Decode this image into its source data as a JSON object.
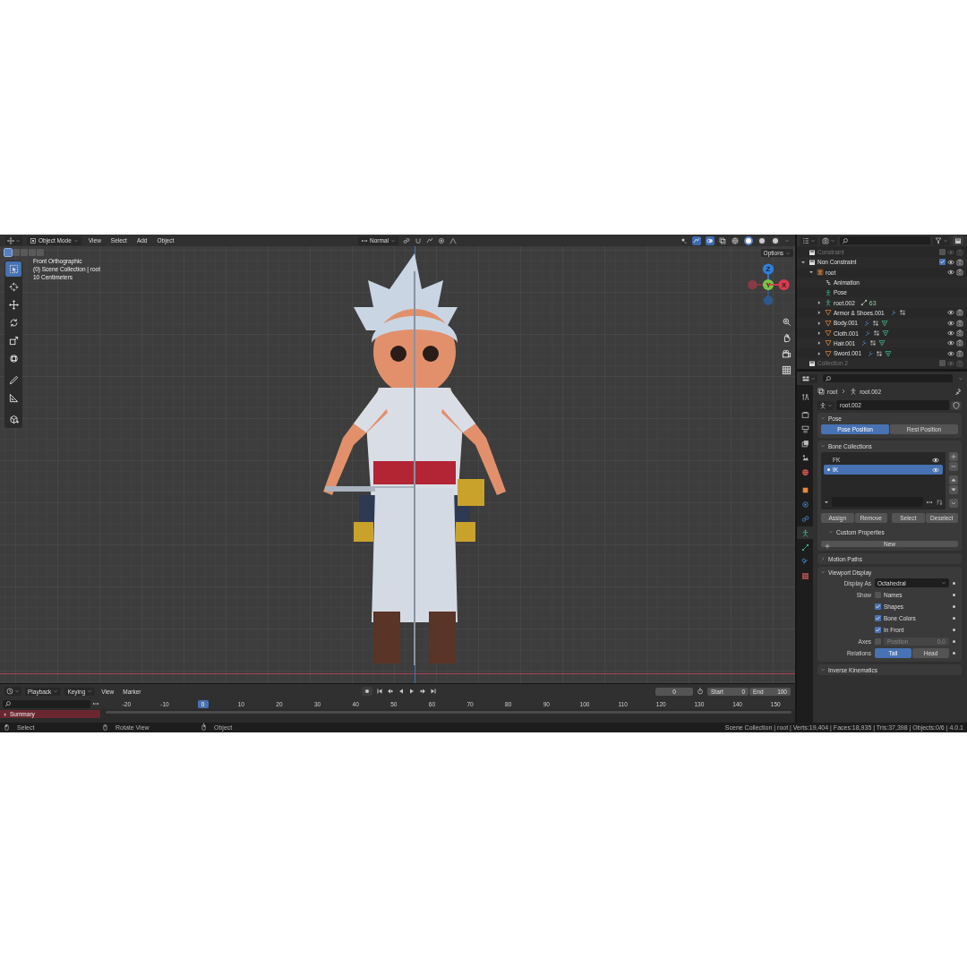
{
  "viewport": {
    "header": {
      "mode": "Object Mode",
      "menus": [
        "View",
        "Select",
        "Add",
        "Object"
      ],
      "orientation": "Normal"
    },
    "shading_modes": [
      {
        "selected": false
      },
      {
        "selected": true
      },
      {
        "selected": false
      },
      {
        "selected": false
      }
    ],
    "select_modes": [
      {
        "selected": true
      },
      {
        "selected": false
      },
      {
        "selected": false
      },
      {
        "selected": false
      },
      {
        "selected": false
      }
    ],
    "tools": [
      {
        "kind": "select-box",
        "selected": true
      },
      {
        "kind": "cursor",
        "selected": false
      },
      {
        "kind": "move",
        "selected": false
      },
      {
        "kind": "rotate",
        "selected": false
      },
      {
        "kind": "scale",
        "selected": false
      },
      {
        "kind": "transform",
        "selected": false
      },
      {
        "kind": "annotate",
        "selected": false
      },
      {
        "kind": "measure",
        "selected": false
      },
      {
        "kind": "add-cube",
        "selected": false
      }
    ],
    "info": [
      "Front Orthographic",
      "(0) Scene Collection | root",
      "10 Centimeters"
    ],
    "options": "Options",
    "gizmo": [
      {
        "label": "Z",
        "kind": "up",
        "color": "#2f7fd9"
      },
      {
        "label": "Y",
        "kind": "center",
        "color": "#7bc443"
      },
      {
        "label": "X",
        "kind": "right",
        "color": "#db3a4e"
      }
    ]
  },
  "outliner": {
    "items": [
      {
        "name": "Constraint",
        "kind": "collection",
        "checked": false
      },
      {
        "name": "Non Constraint",
        "kind": "collection",
        "checked": true,
        "expanded": true,
        "children": [
          {
            "name": "root",
            "kind": "armature",
            "expanded": true,
            "children": [
              {
                "name": "Animation",
                "kind": "animation"
              },
              {
                "name": "Pose",
                "kind": "pose"
              },
              {
                "name": "root.002",
                "kind": "bones",
                "expanded": false,
                "count": "63"
              },
              {
                "name": "Armor & Shoes.001",
                "kind": "mesh",
                "expanded": false,
                "mesh_data": false
              },
              {
                "name": "Body.001",
                "kind": "mesh",
                "expanded": false,
                "mesh_data": true
              },
              {
                "name": "Cloth.001",
                "kind": "mesh",
                "expanded": false,
                "mesh_data": true
              },
              {
                "name": "Hair.001",
                "kind": "mesh",
                "expanded": false,
                "mesh_data": true
              },
              {
                "name": "Sword.001",
                "kind": "mesh",
                "expanded": false,
                "mesh_data": true
              }
            ]
          }
        ]
      },
      {
        "name": "Collection 2",
        "kind": "collection",
        "checked": false
      }
    ]
  },
  "properties": {
    "tabs": [
      {
        "kind": "tool",
        "selected": false
      },
      {
        "kind": "render",
        "selected": false
      },
      {
        "kind": "output",
        "selected": false
      },
      {
        "kind": "view-layer",
        "selected": false
      },
      {
        "kind": "scene",
        "selected": false
      },
      {
        "kind": "world",
        "selected": false
      },
      {
        "kind": "object",
        "selected": false
      },
      {
        "kind": "physics",
        "selected": false
      },
      {
        "kind": "constraint",
        "selected": false
      },
      {
        "kind": "armature",
        "selected": true
      },
      {
        "kind": "bone",
        "selected": false
      },
      {
        "kind": "bone-constraint",
        "selected": false
      },
      {
        "kind": "texture",
        "selected": false
      }
    ],
    "breadcrumb": [
      "root",
      "root.002"
    ],
    "datablock": "root.002",
    "pose": {
      "title": "Pose",
      "expanded": true,
      "options": [
        {
          "label": "Pose Position",
          "selected": true
        },
        {
          "label": "Rest Position",
          "selected": false
        }
      ]
    },
    "bone_collections": {
      "title": "Bone Collections",
      "expanded": true,
      "items": [
        {
          "name": "FK",
          "selected": false
        },
        {
          "name": "IK",
          "selected": true
        }
      ],
      "buttons": [
        "Assign",
        "Remove",
        "Select",
        "Deselect"
      ],
      "custom_properties": {
        "title": "Custom Properties",
        "expanded": true,
        "button": "New"
      }
    },
    "motion_paths": {
      "title": "Motion Paths",
      "expanded": false
    },
    "viewport_display": {
      "title": "Viewport Display",
      "expanded": true,
      "display_as_label": "Display As",
      "display_as": "Octahedral",
      "show_label": "Show",
      "show": [
        {
          "label": "Names",
          "checked": false
        },
        {
          "label": "Shapes",
          "checked": true
        },
        {
          "label": "Bone Colors",
          "checked": true
        },
        {
          "label": "In Front",
          "checked": true
        }
      ],
      "axes": {
        "label": "Axes",
        "checked": false,
        "position_label": "Position",
        "position_value": "0.0",
        "disabled": true
      },
      "relations_label": "Relations",
      "relations": [
        {
          "label": "Tail",
          "selected": true
        },
        {
          "label": "Head",
          "selected": false
        }
      ]
    },
    "inverse_kinematics": {
      "title": "Inverse Kinematics",
      "expanded": true
    }
  },
  "timeline": {
    "menus": [
      "Playback",
      "Keying",
      "View",
      "Marker"
    ],
    "current_frame": "0",
    "start_label": "Start",
    "start": "0",
    "end_label": "End",
    "end": "100",
    "ticks": [
      {
        "label": "-20",
        "selected": false
      },
      {
        "label": "-10",
        "selected": false
      },
      {
        "label": "0",
        "selected": true
      },
      {
        "label": "10",
        "selected": false
      },
      {
        "label": "20",
        "selected": false
      },
      {
        "label": "30",
        "selected": false
      },
      {
        "label": "40",
        "selected": false
      },
      {
        "label": "50",
        "selected": false
      },
      {
        "label": "60",
        "selected": false
      },
      {
        "label": "70",
        "selected": false
      },
      {
        "label": "80",
        "selected": false
      },
      {
        "label": "90",
        "selected": false
      },
      {
        "label": "100",
        "selected": false
      },
      {
        "label": "110",
        "selected": false
      },
      {
        "label": "120",
        "selected": false
      },
      {
        "label": "130",
        "selected": false
      },
      {
        "label": "140",
        "selected": false
      },
      {
        "label": "150",
        "selected": false
      }
    ],
    "channel": "Summary"
  },
  "status_bar": {
    "items": [
      {
        "kind": "mouse-left",
        "label": "Select"
      },
      {
        "kind": "mouse-middle",
        "label": "Rotate View"
      },
      {
        "kind": "mouse-right",
        "label": "Object"
      }
    ],
    "stats": "Scene Collection | root | Verts:19,404 | Faces:18,935 | Tris:37,398 | Objects:0/6 | 4.0.1"
  }
}
